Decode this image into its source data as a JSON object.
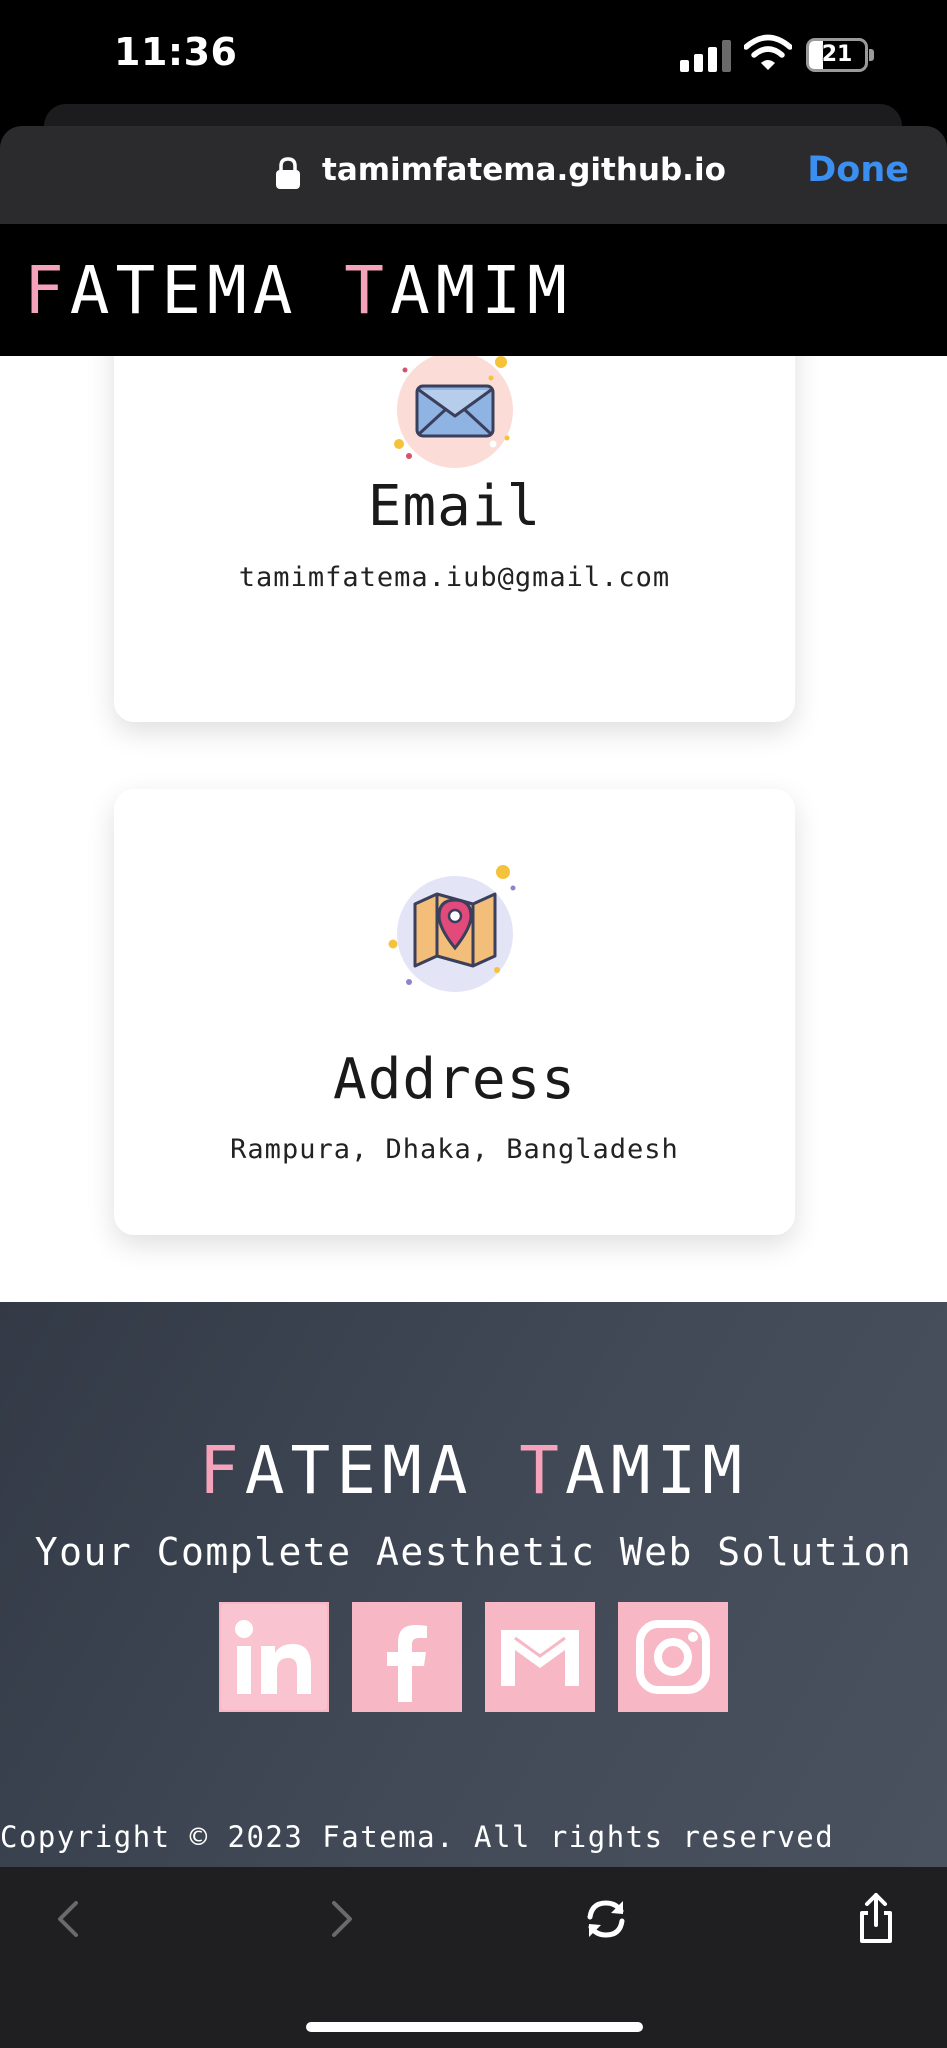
{
  "status_bar": {
    "time": "11:36",
    "battery_level": "21",
    "icons": [
      "signal-icon",
      "wifi-icon",
      "battery-icon"
    ]
  },
  "browser": {
    "url": "tamimfatema.github.io",
    "done_label": "Done",
    "accent_color": "#3b8ff0",
    "icons": [
      "lock-icon",
      "back-icon",
      "forward-icon",
      "reload-icon",
      "share-icon"
    ]
  },
  "site": {
    "brand_first_initial": "F",
    "brand_first_rest": "ATEMA",
    "brand_last_initial": "T",
    "brand_last_rest": "AMIM",
    "accent_color": "#f4a3bb",
    "header_bg": "#000000"
  },
  "contact": {
    "email": {
      "icon": "envelope-icon",
      "title": "Email",
      "value": "tamimfatema.iub@gmail.com"
    },
    "address": {
      "icon": "map-pin-icon",
      "title": "Address",
      "value": "Rampura, Dhaka, Bangladesh"
    }
  },
  "footer": {
    "tagline": "Your Complete Aesthetic Web Solution",
    "socials": [
      {
        "name": "LinkedIn",
        "icon": "linkedin-icon"
      },
      {
        "name": "Facebook",
        "icon": "facebook-icon"
      },
      {
        "name": "Gmail",
        "icon": "gmail-icon"
      },
      {
        "name": "Instagram",
        "icon": "instagram-icon"
      }
    ],
    "copyright": "Copyright © 2023 Fatema. All rights reserved",
    "social_color": "#f7b7c5"
  }
}
